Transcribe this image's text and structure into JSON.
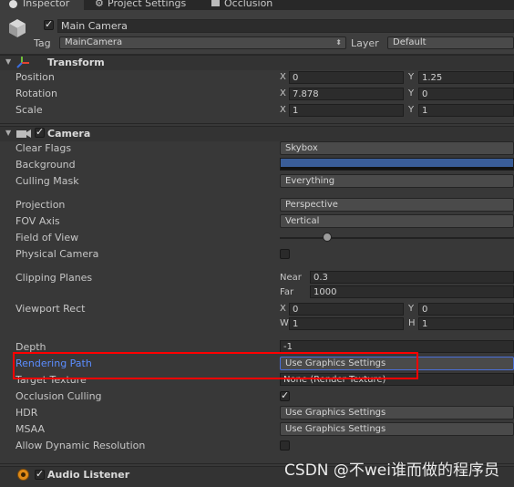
{
  "tabs": [
    {
      "label": "Inspector",
      "icon": "info-icon"
    },
    {
      "label": "Project Settings",
      "icon": "gear-icon"
    },
    {
      "label": "Occlusion",
      "icon": "occlusion-icon"
    }
  ],
  "header": {
    "object_name": "Main Camera",
    "tag_label": "Tag",
    "tag_value": "MainCamera",
    "layer_label": "Layer",
    "layer_value": "Default"
  },
  "transform": {
    "title": "Transform",
    "position_label": "Position",
    "rotation_label": "Rotation",
    "scale_label": "Scale",
    "position": {
      "x": "0",
      "y": "1.25"
    },
    "rotation": {
      "x": "7.878",
      "y": "0"
    },
    "scale": {
      "x": "1",
      "y": "1"
    }
  },
  "camera": {
    "title": "Camera",
    "clear_flags_label": "Clear Flags",
    "clear_flags_value": "Skybox",
    "background_label": "Background",
    "background_color": "#3a5d98",
    "culling_mask_label": "Culling Mask",
    "culling_mask_value": "Everything",
    "projection_label": "Projection",
    "projection_value": "Perspective",
    "fov_axis_label": "FOV Axis",
    "fov_axis_value": "Vertical",
    "field_of_view_label": "Field of View",
    "physical_camera_label": "Physical Camera",
    "clipping_planes_label": "Clipping Planes",
    "near_label": "Near",
    "near_value": "0.3",
    "far_label": "Far",
    "far_value": "1000",
    "viewport_rect_label": "Viewport Rect",
    "viewport": {
      "x": "0",
      "y": "0",
      "w": "1",
      "h": "1"
    },
    "depth_label": "Depth",
    "depth_value": "-1",
    "rendering_path_label": "Rendering Path",
    "rendering_path_value": "Use Graphics Settings",
    "target_texture_label": "Target Texture",
    "target_texture_value": "None (Render Texture)",
    "occlusion_culling_label": "Occlusion Culling",
    "hdr_label": "HDR",
    "hdr_value": "Use Graphics Settings",
    "msaa_label": "MSAA",
    "msaa_value": "Use Graphics Settings",
    "dynamic_res_label": "Allow Dynamic Resolution"
  },
  "audio": {
    "title": "Audio Listener"
  },
  "watermark": "CSDN @不wei谁而做的程序员",
  "colors": {
    "highlight": "#ff0000",
    "link_label": "#5b8dff"
  }
}
